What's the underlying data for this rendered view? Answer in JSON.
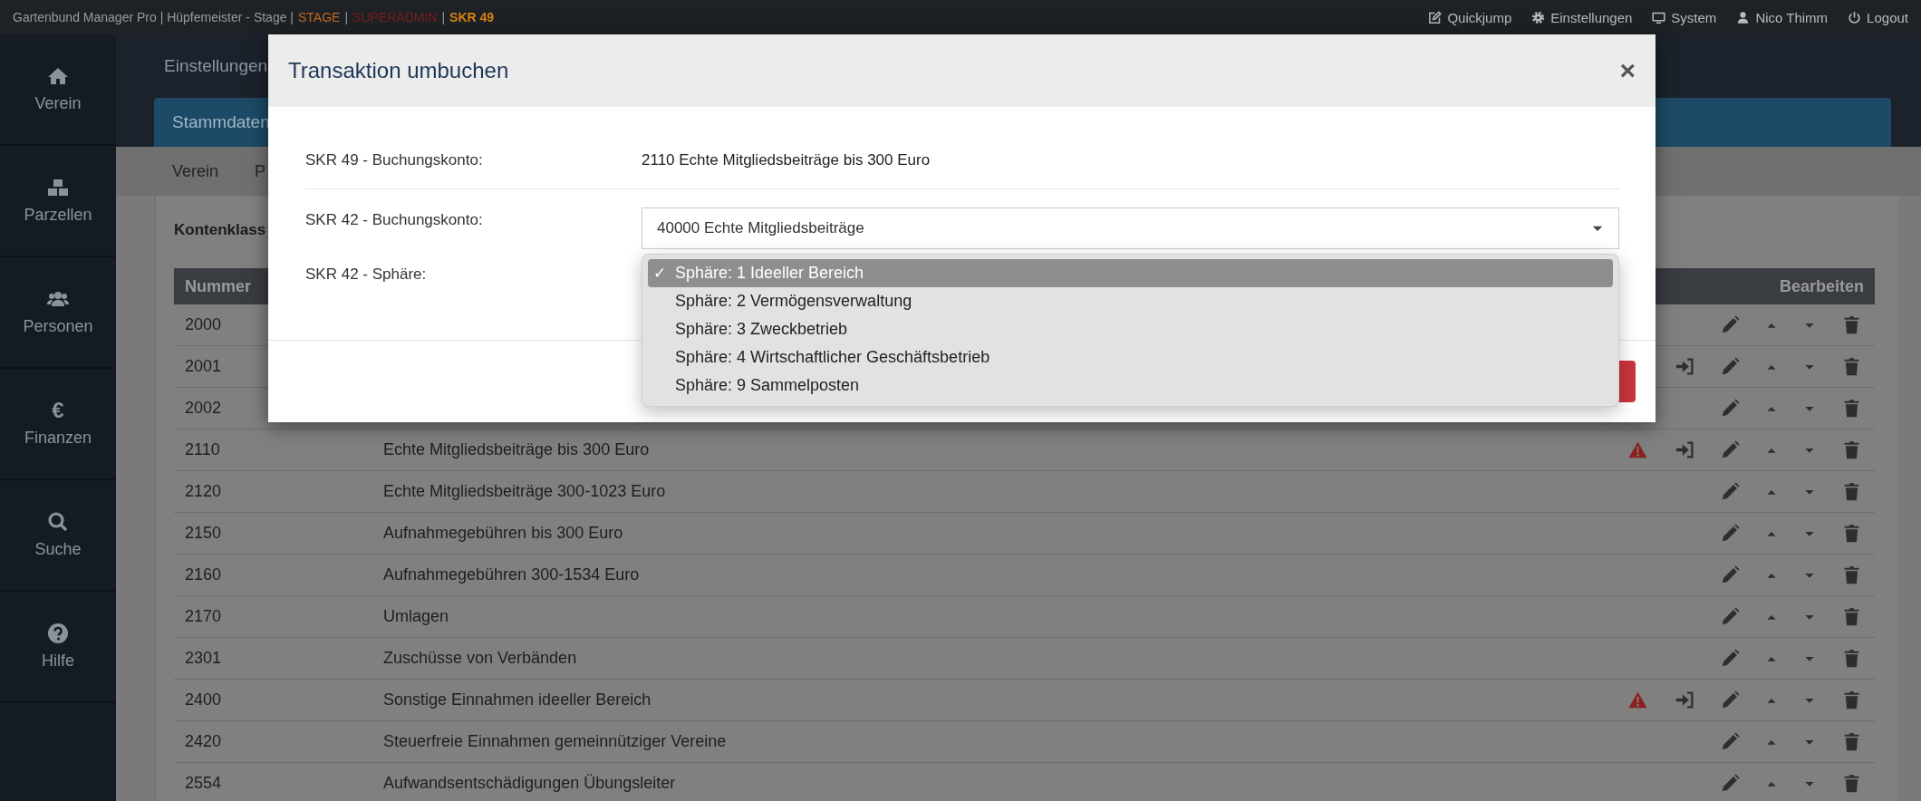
{
  "topbar": {
    "title_parts": [
      {
        "text": "Gartenbund Manager Pro | Hüpfemeister - Stage |",
        "color": "#9a9a9a"
      },
      {
        "text": "STAGE",
        "color": "#c46a1e"
      },
      {
        "text": "|",
        "color": "#9a9a9a"
      },
      {
        "text": "SUPERADMIN",
        "color": "#7a1e16"
      },
      {
        "text": "|",
        "color": "#9a9a9a"
      },
      {
        "text": "SKR 49",
        "color": "#d9820f"
      }
    ],
    "links": [
      {
        "label": "Quickjump"
      },
      {
        "label": "Einstellungen"
      },
      {
        "label": "System"
      },
      {
        "label": "Nico Thimm"
      },
      {
        "label": "Logout"
      }
    ]
  },
  "sidebar": {
    "items": [
      {
        "label": "Verein"
      },
      {
        "label": "Parzellen"
      },
      {
        "label": "Personen"
      },
      {
        "label": "Finanzen",
        "icon_char": "€"
      },
      {
        "label": "Suche"
      },
      {
        "label": "Hilfe"
      }
    ]
  },
  "page": {
    "title": "Einstellungen",
    "tabs": [
      {
        "label": "Stammdaten"
      }
    ],
    "subnav": [
      {
        "label": "Verein"
      },
      {
        "label": "P"
      }
    ],
    "card_title": "Kontenklass"
  },
  "table": {
    "columns": [
      {
        "label": "Nummer"
      },
      {
        "label": "Bearbeiten"
      }
    ],
    "rows": [
      {
        "number": "2000",
        "warning": false,
        "transfer": false
      },
      {
        "number": "2001",
        "warning": false,
        "transfer": true
      },
      {
        "number": "2002",
        "warning": false,
        "transfer": false
      },
      {
        "number": "2110",
        "description": "Echte Mitgliedsbeiträge bis 300 Euro",
        "warning": true,
        "transfer": true
      },
      {
        "number": "2120",
        "description": "Echte Mitgliedsbeiträge 300-1023 Euro",
        "warning": false,
        "transfer": false
      },
      {
        "number": "2150",
        "description": "Aufnahmegebühren bis 300 Euro",
        "warning": false,
        "transfer": false
      },
      {
        "number": "2160",
        "description": "Aufnahmegebühren 300-1534 Euro",
        "warning": false,
        "transfer": false
      },
      {
        "number": "2170",
        "description": "Umlagen",
        "warning": false,
        "transfer": false
      },
      {
        "number": "2301",
        "description": "Zuschüsse von Verbänden",
        "warning": false,
        "transfer": false
      },
      {
        "number": "2400",
        "description": "Sonstige Einnahmen ideeller Bereich",
        "warning": true,
        "transfer": true
      },
      {
        "number": "2420",
        "description": "Steuerfreie Einnahmen gemeinnütziger Vereine",
        "warning": false,
        "transfer": false
      },
      {
        "number": "2554",
        "description": "Aufwandsentschädigungen Übungsleiter",
        "warning": false,
        "transfer": false
      }
    ]
  },
  "modal": {
    "title": "Transaktion umbuchen",
    "close": "×",
    "fields": [
      {
        "kind": "text",
        "label": "SKR 49 - Buchungskonto:",
        "value": "2110 Echte Mitgliedsbeiträge bis 300 Euro"
      },
      {
        "kind": "select",
        "label": "SKR 42 - Buchungskonto:",
        "value": "40000 Echte Mitgliedsbeiträge"
      },
      {
        "kind": "open-select",
        "label": "SKR 42 - Sphäre:",
        "check": "✓",
        "options": [
          {
            "label": "Sphäre: 1 Ideeller Bereich",
            "selected": true
          },
          {
            "label": "Sphäre: 2 Vermögensverwaltung",
            "selected": false
          },
          {
            "label": "Sphäre: 3 Zweckbetrieb",
            "selected": false
          },
          {
            "label": "Sphäre: 4 Wirtschaftlicher Geschäftsbetrieb",
            "selected": false
          },
          {
            "label": "Sphäre: 9 Sammelposten",
            "selected": false
          }
        ]
      }
    ],
    "footer_button": {
      "kind": "danger"
    }
  }
}
